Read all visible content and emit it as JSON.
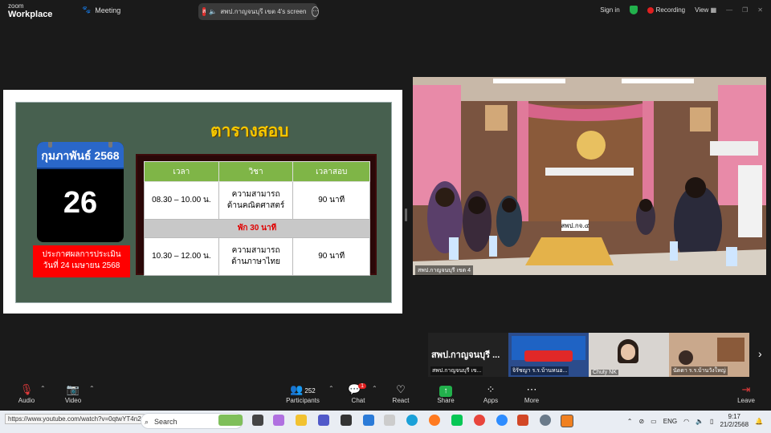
{
  "app": {
    "brand_line1": "zoom",
    "brand_line2": "Workplace",
    "meeting_label": "Meeting"
  },
  "share": {
    "badge": "ส",
    "text": "สพป.กาญจนบุรี เขต 4's screen"
  },
  "topright": {
    "signin": "Sign in",
    "recording": "Recording",
    "view": "View"
  },
  "slide": {
    "title": "ตารางสอบ",
    "calendar_month": "กุมภาพันธ์ 2568",
    "calendar_day": "26",
    "notice_line1": "ประกาศผลการประเมิน",
    "notice_line2": "วันที่ 24 เมษายน 2568",
    "table": {
      "headers": [
        "เวลา",
        "วิชา",
        "เวลาสอบ"
      ],
      "row1": {
        "time": "08.30 – 10.00 น.",
        "subject_l1": "ความสามารถ",
        "subject_l2": "ด้านคณิตศาสตร์",
        "duration": "90 นาที"
      },
      "break": "พัก 30 นาที",
      "row2": {
        "time": "10.30 – 12.00 น.",
        "subject_l1": "ความสามารถ",
        "subject_l2": "ด้านภาษาไทย",
        "duration": "90 นาที"
      }
    }
  },
  "video_main": {
    "caption": "สพป.กาญจนบุรี เขต 4",
    "sign": "สพป.กจ.๔"
  },
  "thumbs": [
    {
      "title": "สพป.กาญจนบุรี ...",
      "label": "สพป.กาญจนบุรี เข..."
    },
    {
      "label": "จิรัชญา ร.ร.บ้านหนอ..."
    },
    {
      "label": "Chuty NK"
    },
    {
      "label": "นัดดา ร.ร.บ้านวังใหญ่"
    }
  ],
  "toolbar": {
    "audio": "Audio",
    "video": "Video",
    "participants": "Participants",
    "participants_count": "252",
    "chat": "Chat",
    "chat_badge": "1",
    "react": "React",
    "share": "Share",
    "apps": "Apps",
    "more": "More",
    "leave": "Leave"
  },
  "taskbar": {
    "url_tip": "https://www.youtube.com/watch?v=0qtwYT4n2CM",
    "search": "Search",
    "lang": "ENG",
    "time": "9:17",
    "date": "21/2/2568"
  },
  "colors": {
    "slide_bg": "#47604f",
    "title": "#f6c700",
    "header_green": "#7fb547",
    "notice_red": "#ff0000",
    "calendar_blue": "#2a67c9"
  }
}
